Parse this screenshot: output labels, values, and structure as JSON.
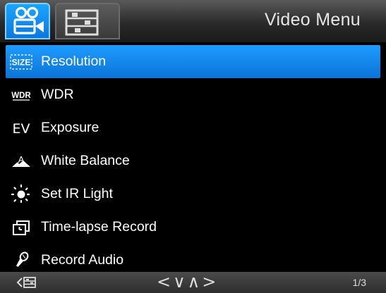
{
  "header": {
    "title": "Video Menu",
    "tabs": [
      {
        "name": "video",
        "icon": "video-camera-icon",
        "active": true
      },
      {
        "name": "setup",
        "icon": "settings-list-icon",
        "active": false
      }
    ]
  },
  "menu": {
    "items": [
      {
        "label": "Resolution",
        "icon": "size-icon",
        "icon_text": "SIZE",
        "selected": true
      },
      {
        "label": "WDR",
        "icon": "wdr-icon",
        "icon_text": "WDR",
        "selected": false
      },
      {
        "label": "Exposure",
        "icon": "ev-icon",
        "icon_text": "EV",
        "selected": false
      },
      {
        "label": "White Balance",
        "icon": "white-balance-icon",
        "icon_text": "A",
        "selected": false
      },
      {
        "label": "Set IR Light",
        "icon": "ir-light-icon",
        "selected": false
      },
      {
        "label": "Time-lapse Record",
        "icon": "time-lapse-icon",
        "selected": false
      },
      {
        "label": "Record Audio",
        "icon": "microphone-icon",
        "selected": false
      }
    ]
  },
  "footer": {
    "back_icon": "back-menu-icon",
    "nav_arrows": "<∨∧>",
    "page": "1/3"
  },
  "colors": {
    "accent": "#0a78e0",
    "background": "#000000"
  }
}
